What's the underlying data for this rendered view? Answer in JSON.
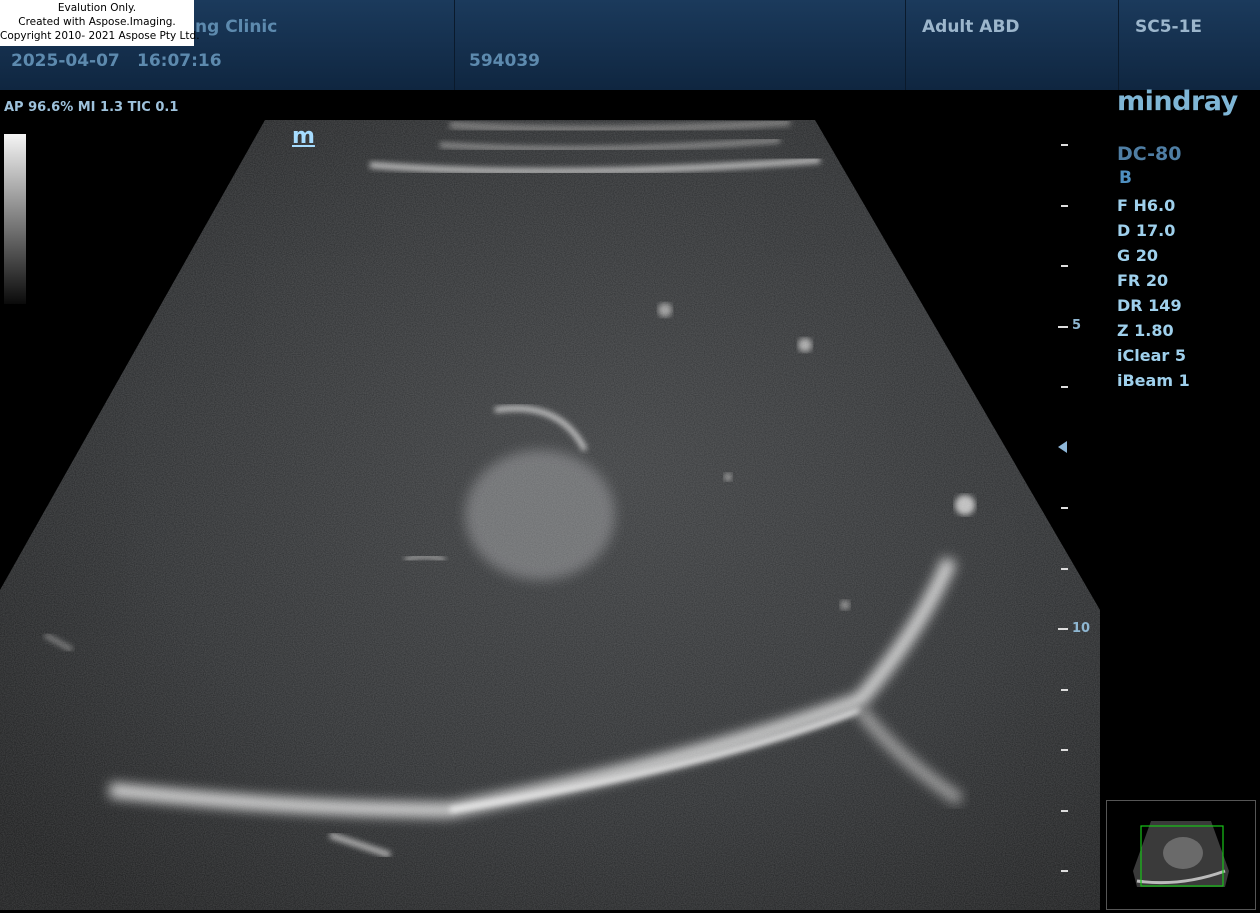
{
  "watermark": {
    "line1": "Evalution Only.",
    "line2": "Created with Aspose.Imaging.",
    "line3": "Copyright 2010- 2021 Aspose Pty Ltd."
  },
  "header": {
    "institution": "ng Clinic",
    "date": "2025-04-07",
    "time": "16:07:16",
    "patient_id": "594039",
    "exam_preset": "Adult ABD",
    "probe": "SC5-1E"
  },
  "acoustic_output": "AP 96.6%  MI 1.3 TIC 0.1",
  "brand": "mindray",
  "image_marker": "m",
  "system_model": "DC-80",
  "imaging_mode": "B",
  "parameters": [
    "F H6.0",
    "D 17.0",
    "G 20",
    "FR 20",
    "DR 149",
    "Z 1.80",
    "iClear 5",
    "iBeam 1"
  ],
  "depth_scale": {
    "label_5": "5",
    "label_10": "10"
  },
  "colors": {
    "header": "#1b3a5c",
    "accent": "#7fb6d6",
    "param_text": "#9fd0ec"
  },
  "icons": {
    "focus": "focus-marker-icon",
    "thumbnail": "sector-thumbnail-icon"
  }
}
